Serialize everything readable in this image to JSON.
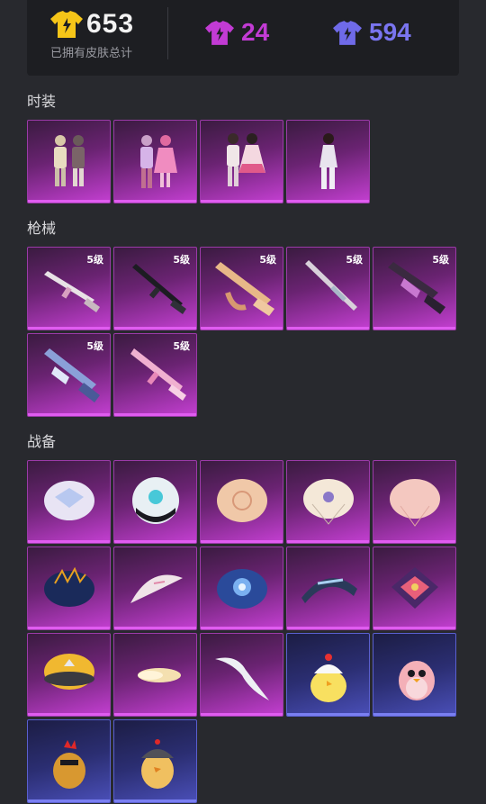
{
  "header": {
    "total_count": "653",
    "total_label": "已拥有皮肤总计",
    "purple_count": "24",
    "indigo_count": "594",
    "colors": {
      "gold": "#f5c518",
      "purple": "#c23bd4",
      "indigo": "#6f6ae8"
    }
  },
  "sections": {
    "outfits": {
      "title": "时装",
      "items": [
        "outfit-duo-1",
        "outfit-duo-2",
        "outfit-duo-3",
        "outfit-single"
      ]
    },
    "weapons": {
      "title": "枪械",
      "level_label": "5级",
      "items": [
        "rifle-1",
        "smg-1",
        "rifle-gold",
        "shotgun",
        "smg-purple",
        "smg-blue",
        "rifle-pink"
      ]
    },
    "gear": {
      "title": "战备",
      "items": [
        "parachute-1",
        "parachute-2",
        "parachute-3",
        "parachute-4",
        "parachute-5",
        "parachute-6",
        "glider-1",
        "parachute-7",
        "parachute-8",
        "parachute-9",
        "parachute-10",
        "cloud",
        "wings",
        "chick-1",
        "pink-bird",
        "rooster",
        "chick-helmet"
      ]
    }
  }
}
